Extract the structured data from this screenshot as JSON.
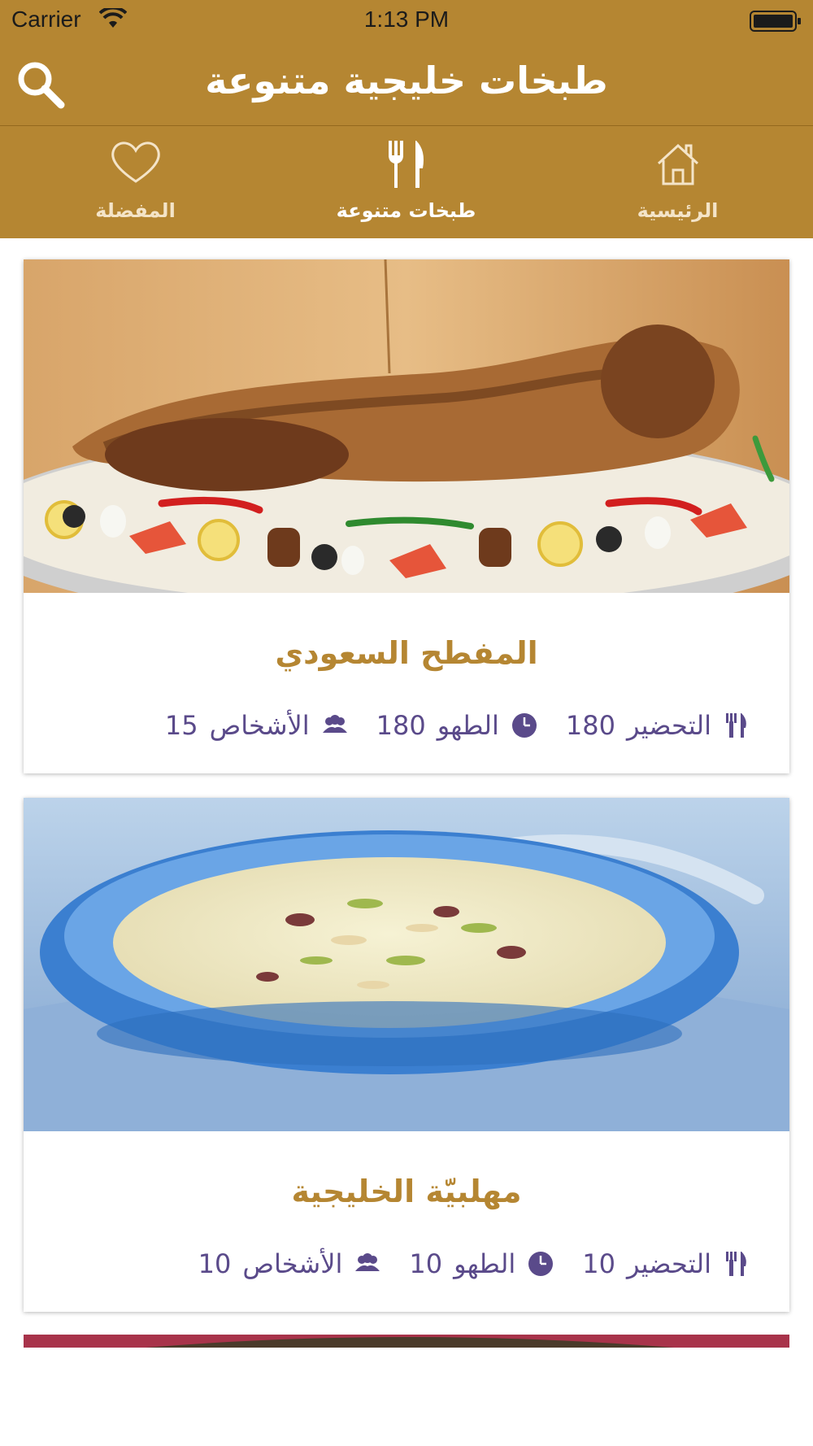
{
  "status_bar": {
    "carrier": "Carrier",
    "time": "1:13 PM"
  },
  "header": {
    "title": "طبخات خليجية متنوعة"
  },
  "tabs": [
    {
      "label": "الرئيسية",
      "icon": "home-icon",
      "active": false
    },
    {
      "label": "طبخات متنوعة",
      "icon": "fork-knife-icon",
      "active": true
    },
    {
      "label": "المفضلة",
      "icon": "heart-icon",
      "active": false
    }
  ],
  "recipes": [
    {
      "title": "المفطح السعودي",
      "prep_label": "التحضير",
      "prep_value": "180",
      "cook_label": "الطهو",
      "cook_value": "180",
      "people_label": "الأشخاص",
      "people_value": "15"
    },
    {
      "title": "مهلبيّة الخليجية",
      "prep_label": "التحضير",
      "prep_value": "10",
      "cook_label": "الطهو",
      "cook_value": "10",
      "people_label": "الأشخاص",
      "people_value": "10"
    }
  ],
  "colors": {
    "brand": "#b58632",
    "meta_text": "#5a4a8a",
    "tab_inactive": "#f4e4c8"
  }
}
